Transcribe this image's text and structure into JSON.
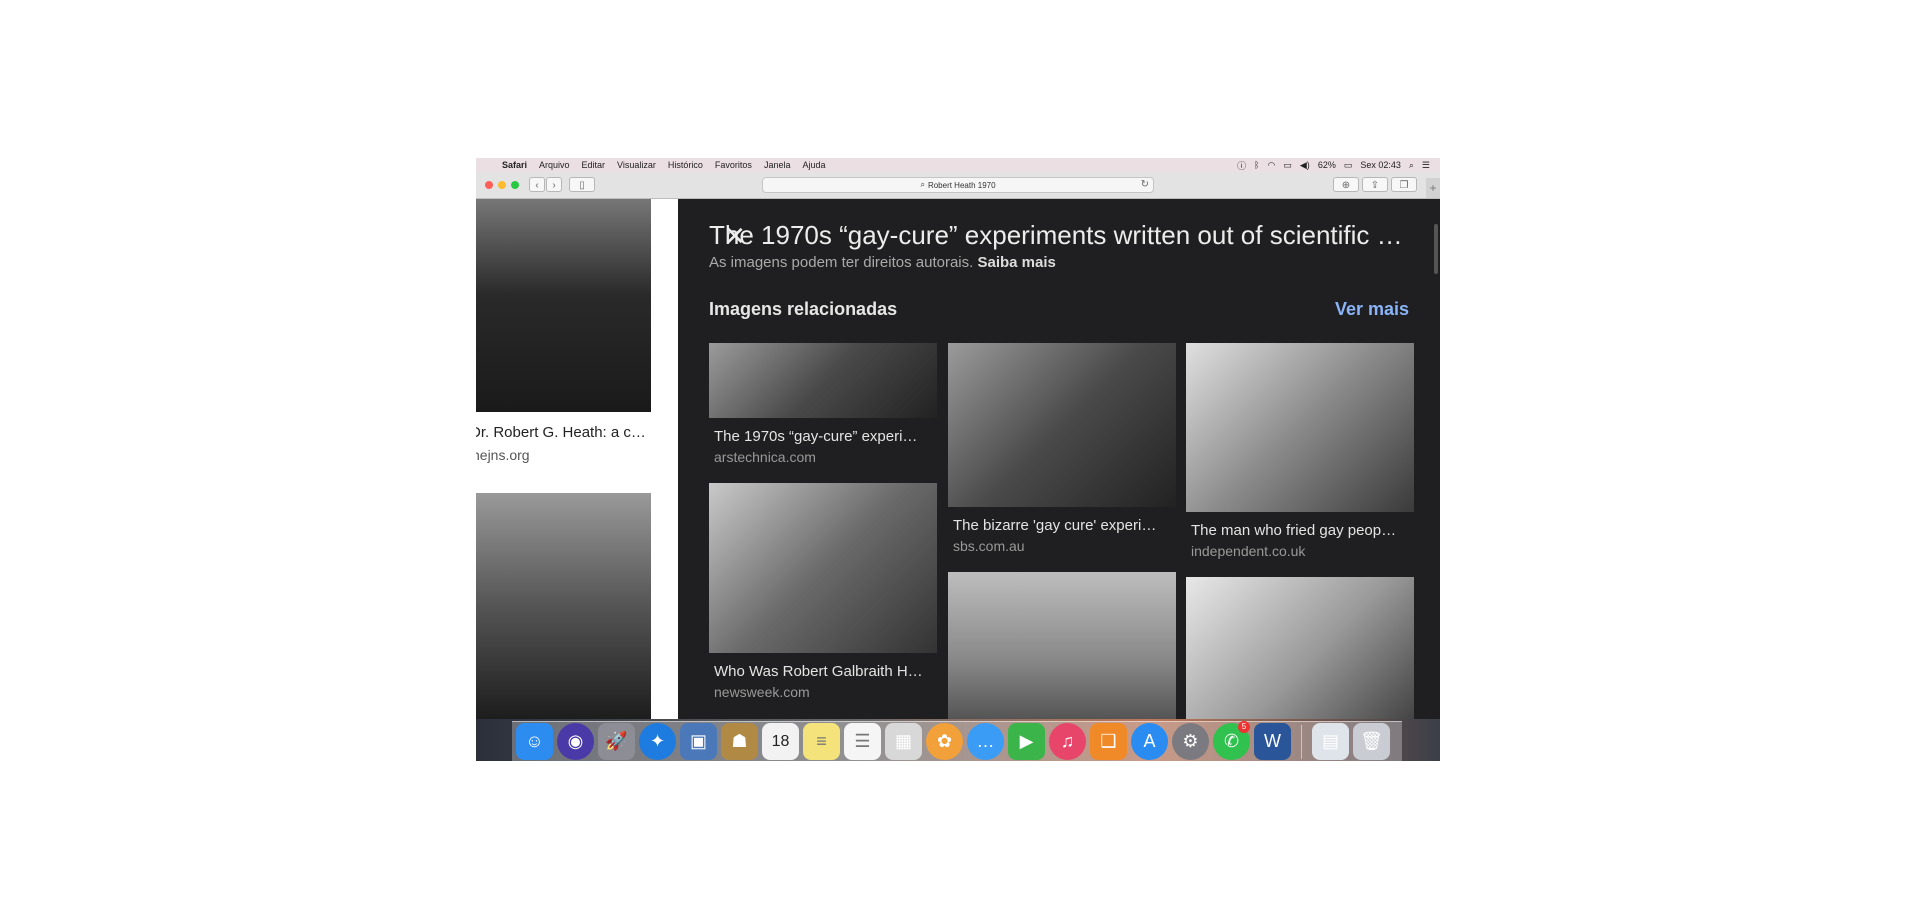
{
  "menubar": {
    "apple": "",
    "items": [
      "Safari",
      "Arquivo",
      "Editar",
      "Visualizar",
      "Histórico",
      "Favoritos",
      "Janela",
      "Ajuda"
    ],
    "battery": "62%",
    "clock": "Sex 02:43"
  },
  "toolbar": {
    "url": "Robert Heath 1970",
    "back": "‹",
    "forward": "›"
  },
  "left_results": [
    {
      "title": "Dr. Robert G. Heath: a c…",
      "domain": "nejns.org"
    }
  ],
  "panel": {
    "title": "The 1970s “gay-cure” experiments written out of scientific h…",
    "copyright": "As imagens podem ter direitos autorais.",
    "learn_more": "Saiba mais",
    "related_heading": "Imagens relacionadas",
    "see_more": "Ver mais",
    "related": [
      {
        "title": "The 1970s “gay-cure” experi…",
        "domain": "arstechnica.com"
      },
      {
        "title": "The bizarre 'gay cure' experi…",
        "domain": "sbs.com.au"
      },
      {
        "title": "The man who fried gay peop…",
        "domain": "independent.co.uk"
      },
      {
        "title": "Who Was Robert Galbraith H…",
        "domain": "newsweek.com"
      }
    ]
  },
  "dock": {
    "apps": [
      {
        "icon": "finder-icon",
        "glyph": "☺",
        "color": "#2d8cf0"
      },
      {
        "icon": "siri-icon",
        "glyph": "◉",
        "color": "#4a3aa8"
      },
      {
        "icon": "launchpad-icon",
        "glyph": "🚀",
        "color": "#8d8d95"
      },
      {
        "icon": "safari-icon",
        "glyph": "✦",
        "color": "#1e7be0"
      },
      {
        "icon": "preview-icon",
        "glyph": "▣",
        "color": "#4a78b8"
      },
      {
        "icon": "contacts-icon",
        "glyph": "☗",
        "color": "#b08a45"
      },
      {
        "icon": "calendar-icon",
        "glyph": "18",
        "color": "#f2f2f2"
      },
      {
        "icon": "notes-icon",
        "glyph": "≡",
        "color": "#f4e27a"
      },
      {
        "icon": "reminders-icon",
        "glyph": "☰",
        "color": "#f5f5f5"
      },
      {
        "icon": "preview-photos-icon",
        "glyph": "▦",
        "color": "#d8d8d8"
      },
      {
        "icon": "photos-icon",
        "glyph": "✿",
        "color": "#f2a03a"
      },
      {
        "icon": "messages-icon",
        "glyph": "…",
        "color": "#3a9cf5"
      },
      {
        "icon": "facetime-icon",
        "glyph": "▶",
        "color": "#3bb54a"
      },
      {
        "icon": "itunes-icon",
        "glyph": "♫",
        "color": "#e8456a"
      },
      {
        "icon": "ibooks-icon",
        "glyph": "❑",
        "color": "#f08a28"
      },
      {
        "icon": "app-store-icon",
        "glyph": "A",
        "color": "#2a8cf0"
      },
      {
        "icon": "system-preferences-icon",
        "glyph": "⚙",
        "color": "#7a7a80"
      },
      {
        "icon": "whatsapp-icon",
        "glyph": "✆",
        "color": "#31c14e",
        "badge": "5"
      },
      {
        "icon": "word-icon",
        "glyph": "W",
        "color": "#2a5699"
      },
      {
        "icon": "downloads-folder-icon",
        "glyph": "▤",
        "color": "#dfe4ea"
      },
      {
        "icon": "trash-icon",
        "glyph": "🗑",
        "color": "#c9ccd2"
      }
    ]
  }
}
